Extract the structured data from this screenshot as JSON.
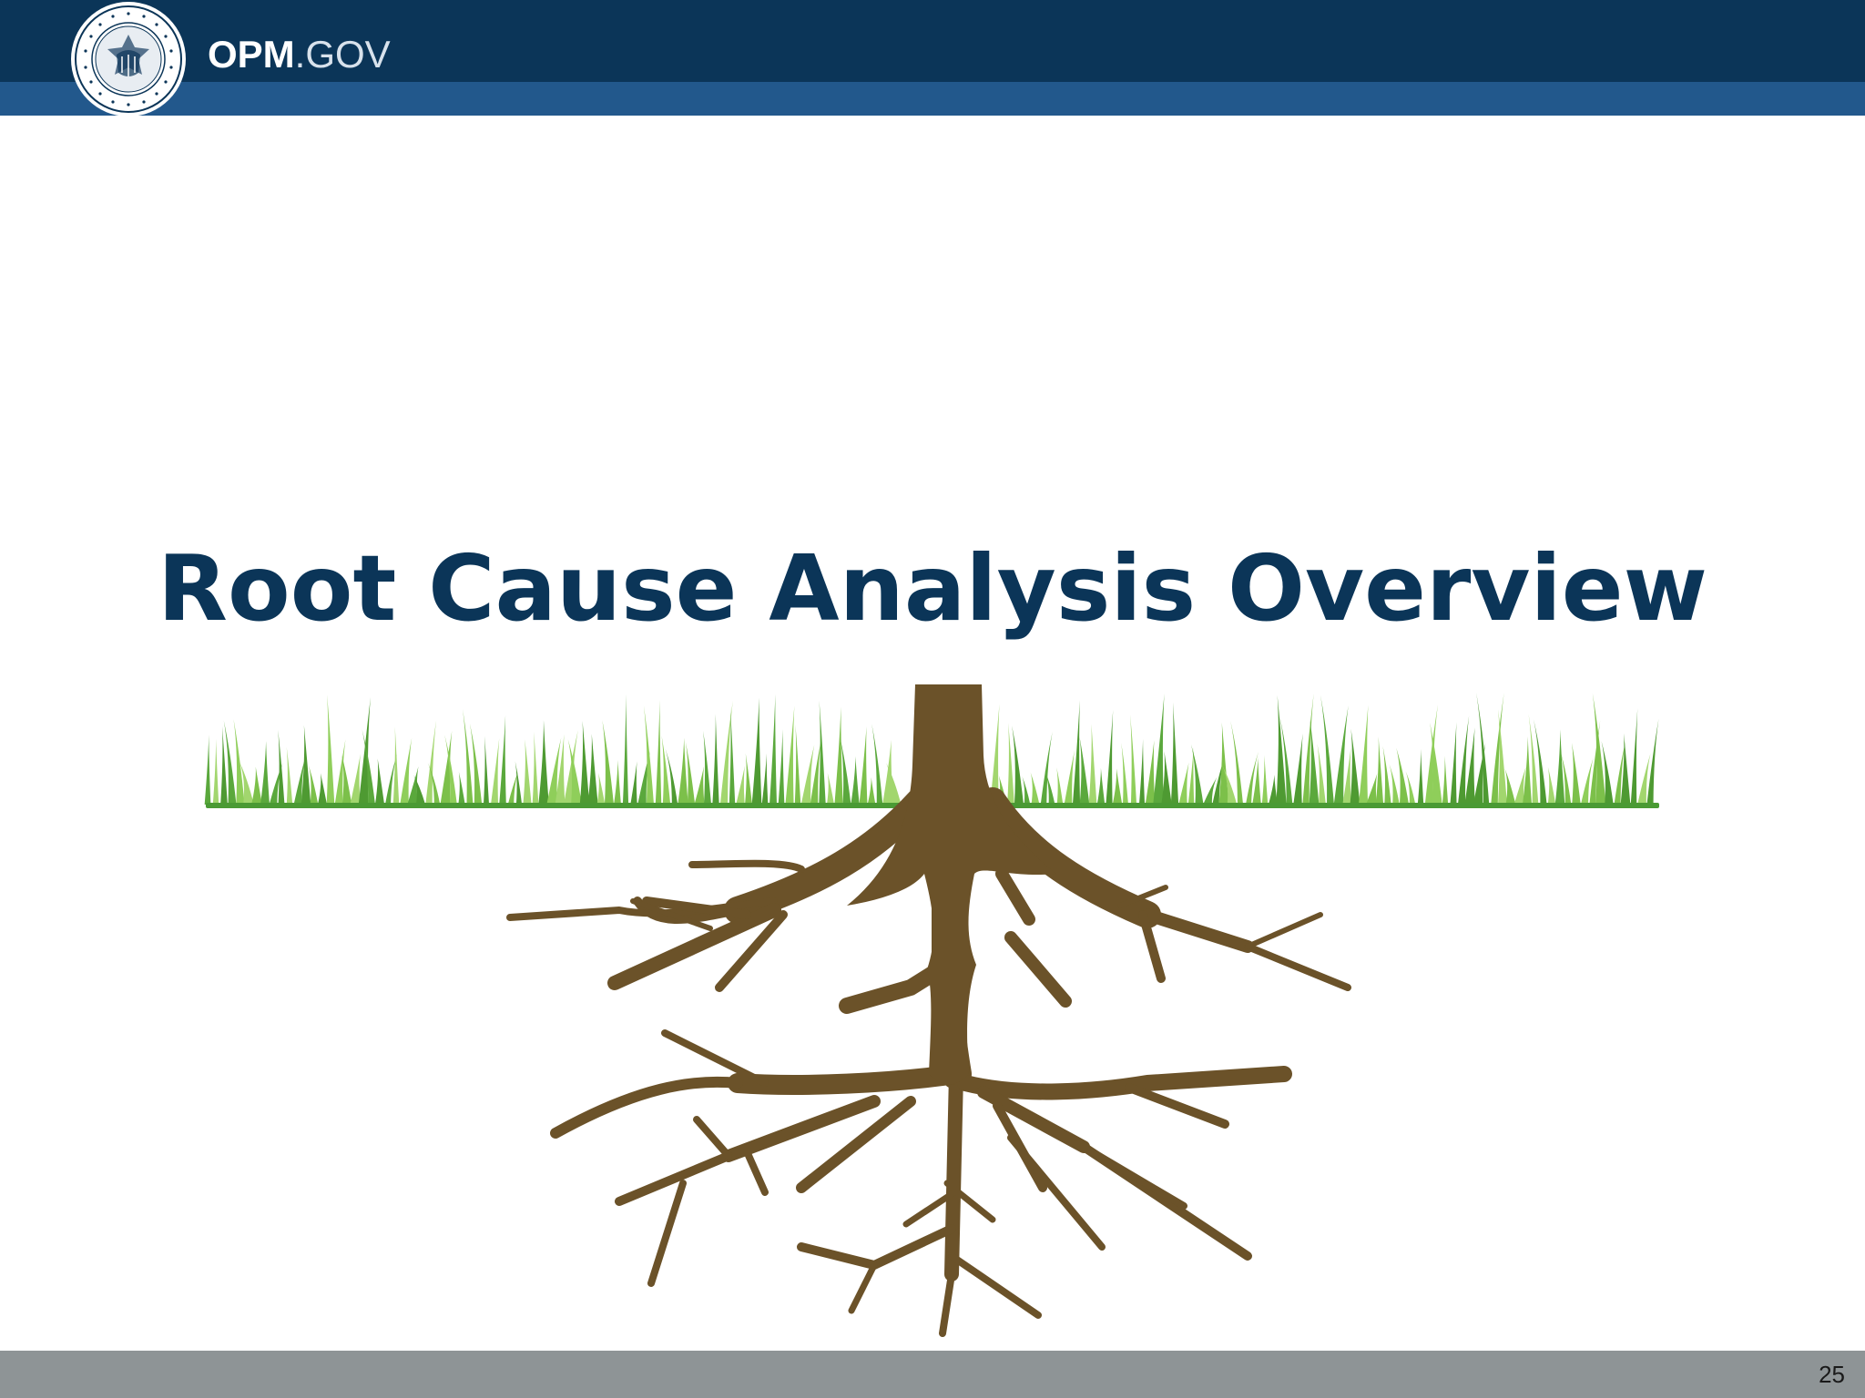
{
  "header": {
    "brand_strong": "OPM",
    "brand_light": ".GOV",
    "seal_text": "UNITED STATES OFFICE OF PERSONNEL MANAGEMENT"
  },
  "slide": {
    "title": "Root Cause Analysis Overview",
    "page_number": "25"
  },
  "colors": {
    "header_dark": "#0b3558",
    "header_band": "#22588c",
    "title": "#0b3558",
    "grass": "#5aa83c",
    "root": "#6b5229",
    "footer": "#8e9496"
  },
  "icons": {
    "seal": "opm-seal-icon",
    "illustration": "tree-root-grass-illustration"
  }
}
